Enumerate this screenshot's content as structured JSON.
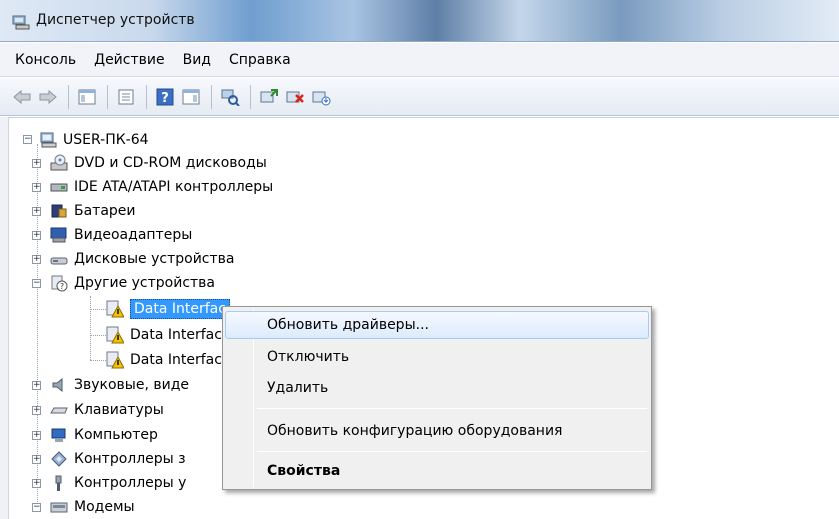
{
  "window": {
    "title": "Диспетчер устройств"
  },
  "menu": [
    "Консоль",
    "Действие",
    "Вид",
    "Справка"
  ],
  "toolbar": {
    "icons": [
      "back-arrow-icon",
      "forward-arrow-icon",
      "show-hide-console-tree-icon",
      "properties-icon",
      "help-icon",
      "action-pane-icon",
      "scan-hardware-icon",
      "update-driver-icon",
      "uninstall-icon",
      "disable-icon"
    ]
  },
  "tree": {
    "root": "USER-ПК-64",
    "items": [
      "DVD и CD-ROM дисководы",
      "IDE ATA/ATAPI контроллеры",
      "Батареи",
      "Видеоадаптеры",
      "Дисковые устройства",
      "Другие устройства",
      "Data Interfac",
      "Data Interfac",
      "Data Interfac",
      "Звуковые, виде",
      "Клавиатуры",
      "Компьютер",
      "Контроллеры з",
      "Контроллеры у",
      "Модемы"
    ]
  },
  "context_menu": {
    "update_drivers": "Обновить драйверы...",
    "disable": "Отключить",
    "delete": "Удалить",
    "scan_hardware": "Обновить конфигурацию оборудования",
    "properties": "Свойства"
  },
  "colors": {
    "selection": "#3399ff",
    "menu_highlight": "#dcebfc"
  }
}
